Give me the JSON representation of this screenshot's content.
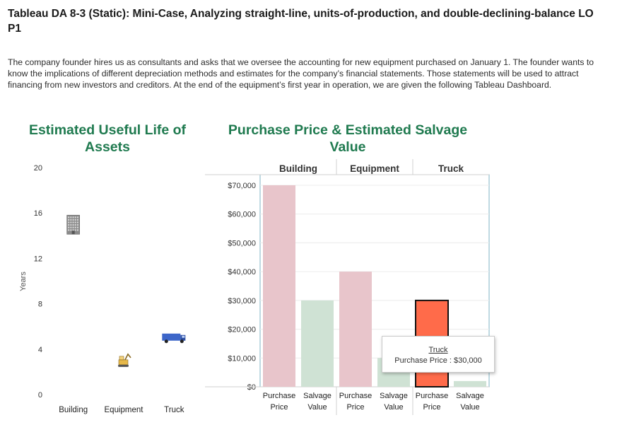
{
  "page": {
    "title": "Tableau DA 8-3 (Static): Mini-Case, Analyzing straight-line, units-of-production, and double-declining-balance LO P1",
    "intro": "The company founder hires us as consultants and asks that we oversee the accounting for new equipment purchased on January 1. The founder wants to know the implications of different depreciation methods and estimates for the company’s financial statements. Those statements will be used to attract financing from new investors and creditors. At the end of the equipment’s first year in operation, we are given the following Tableau Dashboard."
  },
  "chart_data": [
    {
      "type": "scatter",
      "title": "Estimated Useful Life of Assets",
      "ylabel": "Years",
      "ylim": [
        0,
        20
      ],
      "yticks": [
        "0",
        "4",
        "8",
        "12",
        "16",
        "20"
      ],
      "categories": [
        "Building",
        "Equipment",
        "Truck"
      ],
      "values": [
        15,
        3,
        5
      ],
      "icons": [
        "building-icon",
        "excavator-icon",
        "truck-icon"
      ],
      "grid": false
    },
    {
      "type": "bar",
      "title": "Purchase Price & Estimated Salvage Value",
      "groups": [
        "Building",
        "Equipment",
        "Truck"
      ],
      "series": [
        {
          "name": "Purchase Price",
          "label_lines": [
            "Purchase",
            "Price"
          ],
          "values": [
            70000,
            40000,
            30000
          ]
        },
        {
          "name": "Salvage Value",
          "label_lines": [
            "Salvage",
            "Value"
          ],
          "values": [
            30000,
            10000,
            2000
          ]
        }
      ],
      "yticks": [
        "$0",
        "$10,000",
        "$20,000",
        "$30,000",
        "$40,000",
        "$50,000",
        "$60,000",
        "$70,000"
      ],
      "ylim": [
        0,
        70000
      ],
      "colors": {
        "purchase": "#e8c5cb",
        "salvage": "#cfe2d4",
        "highlight": "#ff6b4a",
        "title": "#1f7a4f",
        "frame": "#7fb3c4"
      },
      "highlight": {
        "group": "Truck",
        "series": "Purchase Price"
      },
      "tooltip": {
        "name": "Truck",
        "line": "Purchase Price : $30,000"
      },
      "grid": true
    }
  ]
}
